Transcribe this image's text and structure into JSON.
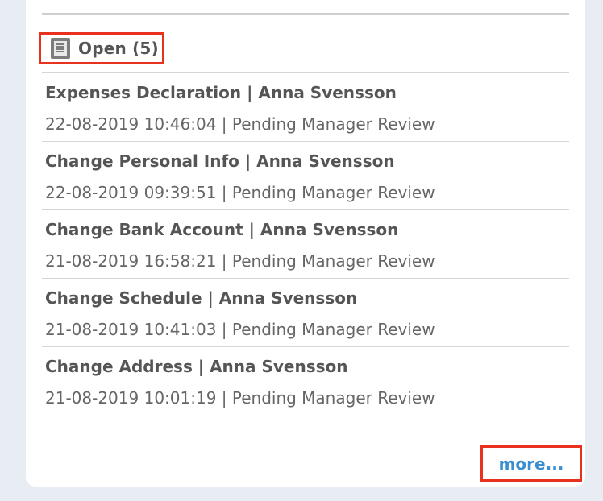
{
  "section": {
    "title": "Open (5)",
    "icon": "document-icon"
  },
  "items": [
    {
      "title": "Expenses Declaration | Anna Svensson",
      "status": "22-08-2019 10:46:04 | Pending Manager Review"
    },
    {
      "title": "Change Personal Info | Anna Svensson",
      "status": "22-08-2019 09:39:51 | Pending Manager Review"
    },
    {
      "title": "Change Bank Account | Anna Svensson",
      "status": "21-08-2019 16:58:21 | Pending Manager Review"
    },
    {
      "title": "Change Schedule | Anna Svensson",
      "status": "21-08-2019 10:41:03 | Pending Manager Review"
    },
    {
      "title": "Change Address | Anna Svensson",
      "status": "21-08-2019 10:01:19 | Pending Manager Review"
    }
  ],
  "more_label": "more...",
  "colors": {
    "highlight": "#e8321e",
    "link": "#3a8fd0",
    "text": "#555555",
    "background": "#e8edf3"
  }
}
